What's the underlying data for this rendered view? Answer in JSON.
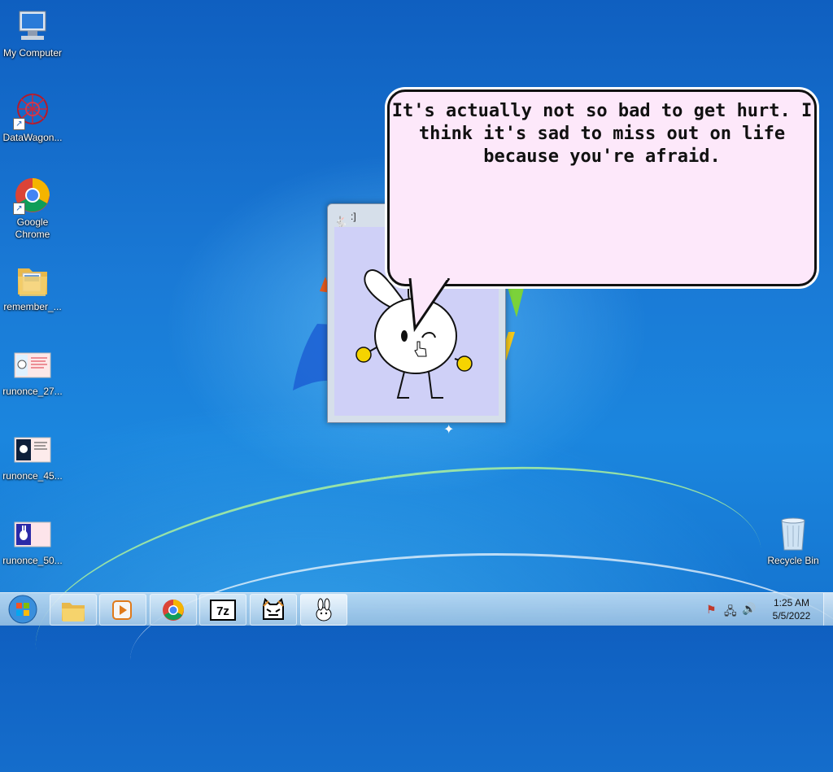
{
  "desktop": {
    "icons": [
      {
        "label": "My Computer",
        "icon": "computer-icon"
      },
      {
        "label": "DataWagon...",
        "icon": "datawagon-icon"
      },
      {
        "label": "Google Chrome",
        "icon": "chrome-icon"
      },
      {
        "label": "remember_...",
        "icon": "folder-icon"
      },
      {
        "label": "runonce_27...",
        "icon": "image-file-icon"
      },
      {
        "label": "runonce_45...",
        "icon": "image-file-icon"
      },
      {
        "label": "runonce_50...",
        "icon": "image-file-icon"
      },
      {
        "label": "Recycle Bin",
        "icon": "recycle-bin-icon"
      }
    ]
  },
  "app_window": {
    "title": ":]",
    "background_color": "#cfd0f7"
  },
  "speech_bubble": {
    "text": "It's actually not so bad to get hurt. I think it's sad to miss out on life because you're afraid.",
    "background_color": "#fde8fa"
  },
  "taskbar": {
    "items": [
      {
        "name": "windows-explorer",
        "icon": "folder-icon"
      },
      {
        "name": "media-player",
        "icon": "media-player-icon"
      },
      {
        "name": "google-chrome",
        "icon": "chrome-icon"
      },
      {
        "name": "7-zip",
        "icon": "7zip-icon",
        "text": "7z"
      },
      {
        "name": "cat-app",
        "icon": "cat-icon"
      },
      {
        "name": "bunny-app",
        "icon": "bunny-icon",
        "active": true
      }
    ],
    "clock": {
      "time": "1:25 AM",
      "date": "5/5/2022"
    }
  }
}
